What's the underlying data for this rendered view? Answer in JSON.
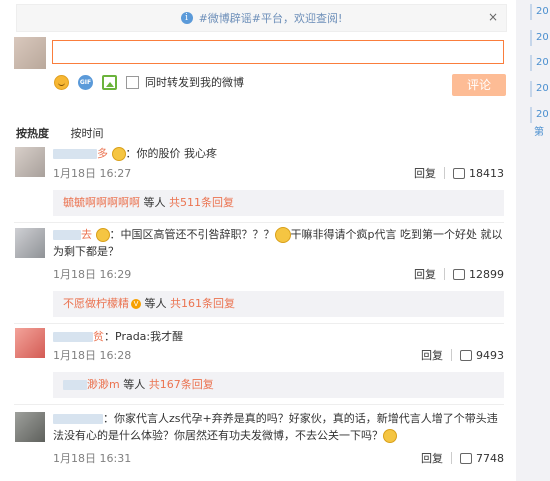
{
  "notice": {
    "text": "#微博辟谣#平台，欢迎查阅!",
    "close": "×"
  },
  "composer": {
    "value": "",
    "sync_label": "同时转发到我的微博",
    "submit": "评论"
  },
  "sort": {
    "hot": "按热度",
    "time": "按时间"
  },
  "right_years": [
    "20",
    "20",
    "20",
    "20",
    "20",
    "第"
  ],
  "comments": [
    {
      "text": "你的股价 我心疼",
      "time": "1月18日 16:27",
      "reply": "回复",
      "likes": "18413",
      "sub_user": "毓毓啊啊啊啊啊",
      "sub_mid": " 等人 ",
      "sub_link": "共511条回复"
    },
    {
      "text": "中国区高管还不引咎辞职？？？",
      "text2": "干嘛非得请个疯p代言 吃到第一个好处 就以为剩下都是？",
      "time": "1月18日 16:29",
      "reply": "回复",
      "likes": "12899",
      "sub_user": "不愿做柠檬精",
      "sub_mid": " 等人 ",
      "sub_link": "共161条回复"
    },
    {
      "text": "Prada:我才醒",
      "time": "1月18日 16:28",
      "reply": "回复",
      "likes": "9493",
      "sub_user": "渺渺m",
      "sub_mid": " 等人 ",
      "sub_link": "共167条回复"
    },
    {
      "text": "你家代言人zs代孕+弃养是真的吗？好家伙，真的话，新增代言人增了个带头违法没有心的是什么体验？你居然还有功夫发微博，不去公关一下吗？",
      "time": "1月18日 16:31",
      "reply": "回复",
      "likes": "7748"
    }
  ]
}
